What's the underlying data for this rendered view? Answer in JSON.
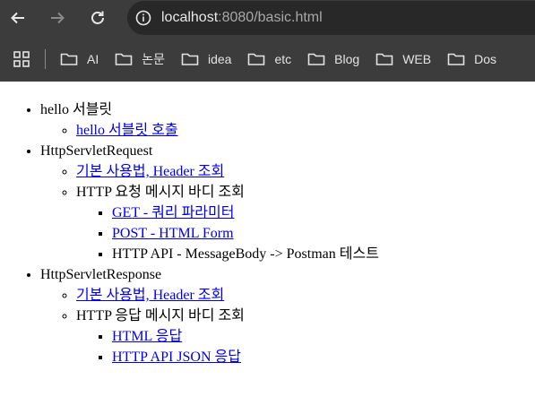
{
  "browser": {
    "url_host": "localhost",
    "url_path": ":8080/basic.html"
  },
  "bookmarks": [
    {
      "label": "AI"
    },
    {
      "label": "논문"
    },
    {
      "label": "idea"
    },
    {
      "label": "etc"
    },
    {
      "label": "Blog"
    },
    {
      "label": "WEB"
    },
    {
      "label": "Dos"
    }
  ],
  "page": {
    "sections": [
      {
        "title": "hello 서블릿",
        "items": [
          {
            "label": "hello 서블릿 호출",
            "link": true
          }
        ]
      },
      {
        "title": "HttpServletRequest",
        "items": [
          {
            "label": "기본 사용법, Header 조회",
            "link": true
          },
          {
            "label": "HTTP 요청 메시지 바디 조회",
            "link": false,
            "children": [
              {
                "label": "GET - 쿼리 파라미터",
                "link": true
              },
              {
                "label": "POST - HTML Form",
                "link": true
              },
              {
                "label": "HTTP API - MessageBody -> Postman 테스트",
                "link": false
              }
            ]
          }
        ]
      },
      {
        "title": "HttpServletResponse",
        "items": [
          {
            "label": "기본 사용법, Header 조회",
            "link": true
          },
          {
            "label": "HTTP 응답 메시지 바디 조회",
            "link": false,
            "children": [
              {
                "label": "HTML 응답",
                "link": true
              },
              {
                "label": "HTTP API JSON 응답",
                "link": true
              }
            ]
          }
        ]
      }
    ]
  }
}
